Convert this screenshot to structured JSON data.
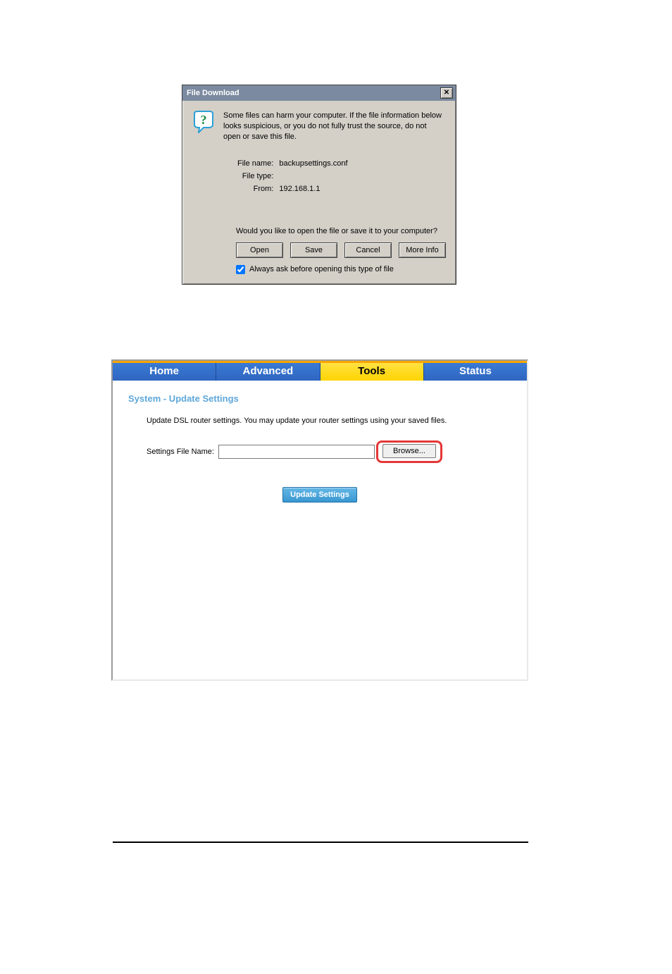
{
  "dialog": {
    "title": "File Download",
    "warning_text": "Some files can harm your computer. If the file information below looks suspicious, or you do not fully trust the source, do not open or save this file.",
    "rows": {
      "filename_label": "File name:",
      "filename_value": "backupsettings.conf",
      "filetype_label": "File type:",
      "filetype_value": "",
      "from_label": "From:",
      "from_value": "192.168.1.1"
    },
    "prompt": "Would you like to open the file or save it to your computer?",
    "buttons": {
      "open": "Open",
      "save": "Save",
      "cancel": "Cancel",
      "more_info": "More Info"
    },
    "always_ask_label": "Always ask before opening this type of file",
    "always_ask_checked": true,
    "icon_name": "question-icon"
  },
  "router": {
    "tabs": {
      "home": "Home",
      "advanced": "Advanced",
      "tools": "Tools",
      "status": "Status",
      "active": "tools"
    },
    "heading": "System - Update Settings",
    "description": "Update DSL router settings. You may update your router settings using your saved files.",
    "file_label": "Settings File Name:",
    "file_value": "",
    "browse_label": "Browse...",
    "update_label": "Update Settings"
  }
}
